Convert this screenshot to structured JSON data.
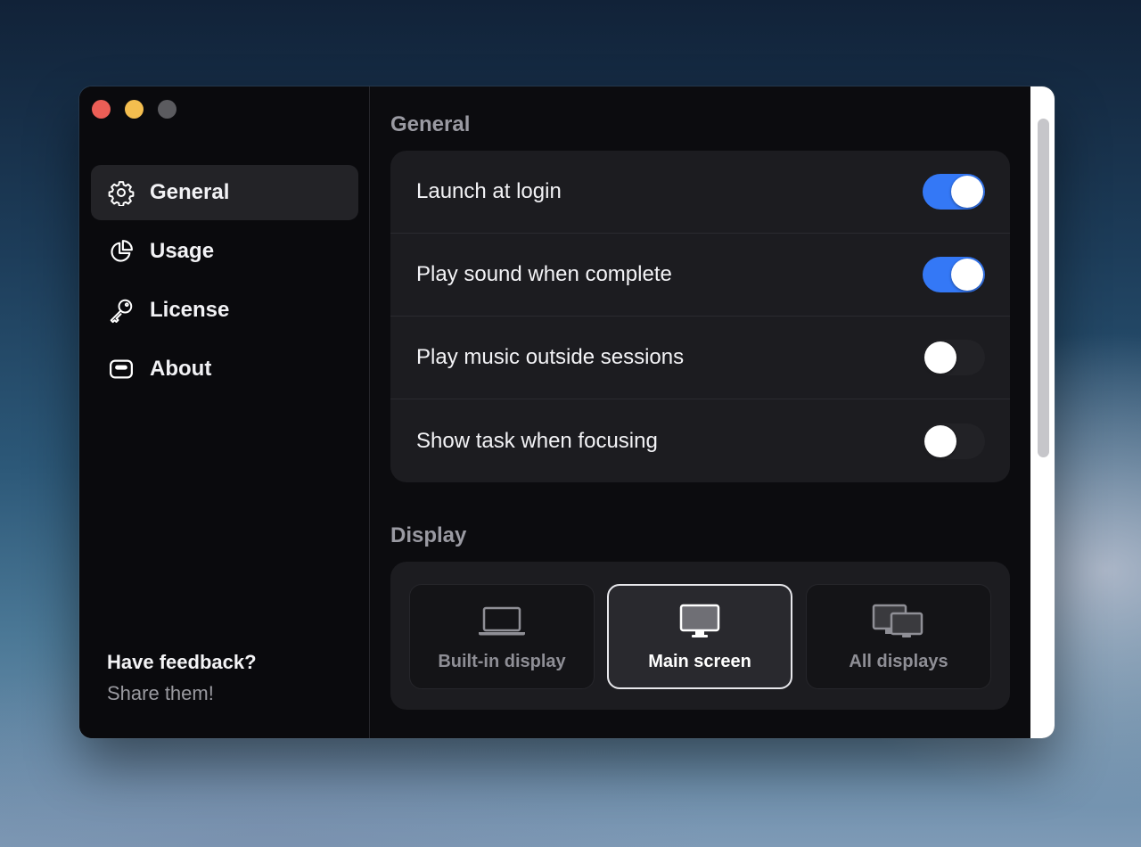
{
  "window": {
    "traffic_lights": [
      "close",
      "minimize",
      "maximize"
    ]
  },
  "sidebar": {
    "items": [
      {
        "label": "General",
        "icon": "gear-icon",
        "active": true
      },
      {
        "label": "Usage",
        "icon": "pie-chart-icon",
        "active": false
      },
      {
        "label": "License",
        "icon": "key-icon",
        "active": false
      },
      {
        "label": "About",
        "icon": "about-icon",
        "active": false
      }
    ],
    "feedback": {
      "title": "Have feedback?",
      "link": "Share them!"
    }
  },
  "general": {
    "title": "General",
    "settings": [
      {
        "label": "Launch at login",
        "on": true
      },
      {
        "label": "Play sound when complete",
        "on": true
      },
      {
        "label": "Play music outside sessions",
        "on": false
      },
      {
        "label": "Show task when focusing",
        "on": false
      }
    ]
  },
  "display": {
    "title": "Display",
    "options": [
      {
        "label": "Built-in display",
        "icon": "laptop-icon",
        "selected": false
      },
      {
        "label": "Main screen",
        "icon": "monitor-icon",
        "selected": true
      },
      {
        "label": "All displays",
        "icon": "multi-display-icon",
        "selected": false
      }
    ]
  },
  "colors": {
    "accent": "#3478f6",
    "close": "#ec5e56",
    "minimize": "#f4be4f",
    "maximize": "#5b5b5f"
  }
}
